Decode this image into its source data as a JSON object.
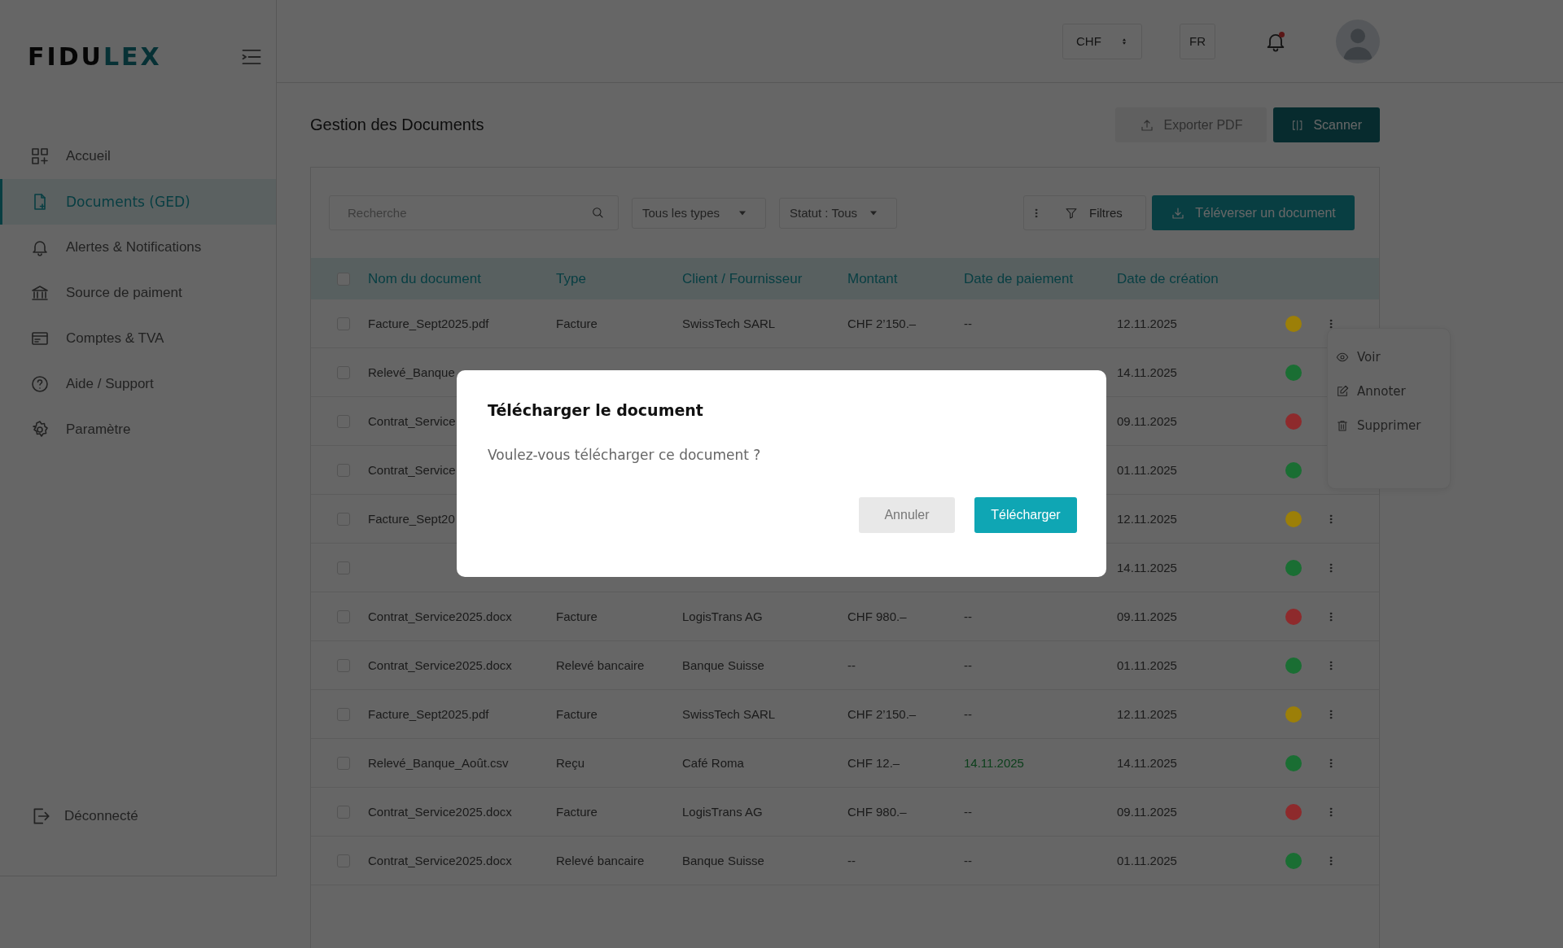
{
  "logo": {
    "dark": "FIDU",
    "accent": "LEX"
  },
  "sidebar": {
    "items": [
      {
        "label": "Accueil",
        "selected": false
      },
      {
        "label": "Documents (GED)",
        "selected": true
      },
      {
        "label": "Alertes & Notifications",
        "selected": false
      },
      {
        "label": "Source de paiment",
        "selected": false
      },
      {
        "label": "Comptes & TVA",
        "selected": false
      },
      {
        "label": "Aide / Support",
        "selected": false
      },
      {
        "label": "Paramètre",
        "selected": false
      }
    ],
    "logout": "Déconnecté"
  },
  "header": {
    "currency": "CHF",
    "language": "FR",
    "notification_unread": true
  },
  "page": {
    "title": "Gestion des Documents",
    "buttons": [
      {
        "label": "Exporter PDF",
        "kind": "secondary"
      },
      {
        "label": "Scanner",
        "kind": "dark"
      }
    ]
  },
  "toolbar": {
    "search_placeholder": "Recherche",
    "type_filter": "Tous les types",
    "status_filter": "Statut : Tous",
    "filters_label": "Filtres",
    "upload_label": "Téléverser un document"
  },
  "table": {
    "select_all_checked": false,
    "columns": [
      "Nom du document",
      "Type",
      "Client / Fournisseur",
      "Montant",
      "Date de paiement",
      "Date de création"
    ],
    "rows": [
      {
        "checked": false,
        "name": "Facture_Sept2025.pdf",
        "type": "Facture",
        "client": "SwissTech SARL",
        "amount": "CHF 2’150.–",
        "pay_date": "--",
        "pay_date_paid": false,
        "created": "12.11.2025",
        "color": "#9c7f08"
      },
      {
        "checked": false,
        "name": "Relevé_Banque",
        "created": "14.11.2025",
        "color": "#1a6e33"
      },
      {
        "checked": false,
        "name": "Contrat_Service",
        "created": "09.11.2025",
        "color": "#8e2a2c"
      },
      {
        "checked": false,
        "name": "Contrat_Service",
        "created": "01.11.2025",
        "color": "#1a6e33"
      },
      {
        "checked": false,
        "name": "Facture_Sept20",
        "created": "12.11.2025",
        "color": "#9c7f08"
      },
      {
        "checked": false,
        "created": "14.11.2025",
        "color": "#1a6e33"
      },
      {
        "checked": false,
        "name": "Contrat_Service2025.docx",
        "type": "Facture",
        "client": "LogisTrans AG",
        "amount": "CHF 980.–",
        "pay_date": "--",
        "pay_date_paid": false,
        "created": "09.11.2025",
        "color": "#8e2a2c"
      },
      {
        "checked": false,
        "name": "Contrat_Service2025.docx",
        "type": "Relevé bancaire",
        "client": "Banque Suisse",
        "amount": "--",
        "pay_date": "--",
        "pay_date_paid": false,
        "created": "01.11.2025",
        "color": "#1a6e33"
      },
      {
        "checked": false,
        "name": "Facture_Sept2025.pdf",
        "type": "Facture",
        "client": "SwissTech SARL",
        "amount": "CHF 2’150.–",
        "pay_date": "--",
        "pay_date_paid": false,
        "created": "12.11.2025",
        "color": "#9c7f08"
      },
      {
        "checked": false,
        "name": "Relevé_Banque_Août.csv",
        "type": "Reçu",
        "client": "Café Roma",
        "amount": "CHF 12.–",
        "pay_date": "14.11.2025",
        "pay_date_paid": true,
        "created": "14.11.2025",
        "color": "#1a6e33"
      },
      {
        "checked": false,
        "name": "Contrat_Service2025.docx",
        "type": "Facture",
        "client": "LogisTrans AG",
        "amount": "CHF 980.–",
        "pay_date": "--",
        "pay_date_paid": false,
        "created": "09.11.2025",
        "color": "#8e2a2c"
      },
      {
        "checked": false,
        "name": "Contrat_Service2025.docx",
        "type": "Relevé bancaire",
        "client": "Banque Suisse",
        "amount": "--",
        "pay_date": "--",
        "pay_date_paid": false,
        "created": "01.11.2025",
        "color": "#1a6e33"
      }
    ]
  },
  "row_menu": {
    "items": [
      "Voir",
      "Annoter",
      "Supprimer"
    ]
  },
  "dialog": {
    "title": "Télécharger le document",
    "message": "Voulez-vous télécharger ce document ?",
    "buttons": [
      {
        "label": "Annuler",
        "kind": "cancel"
      },
      {
        "label": "Télécharger",
        "kind": "primary"
      }
    ]
  }
}
